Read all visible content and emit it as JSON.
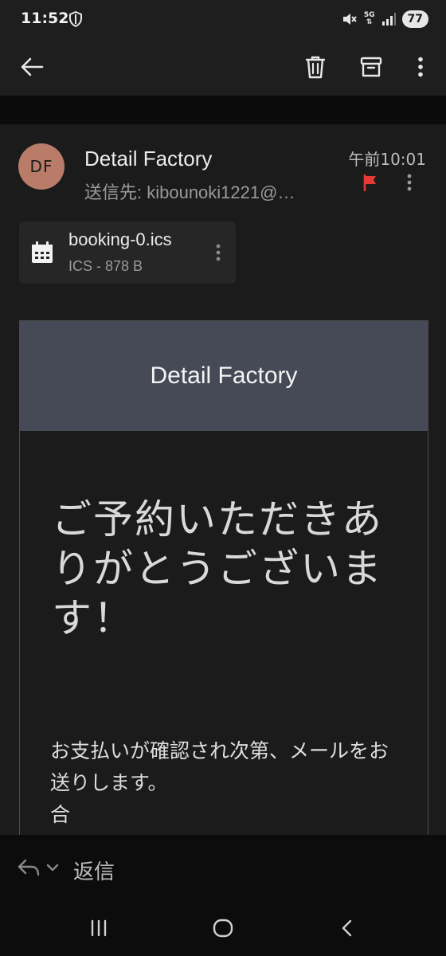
{
  "status_bar": {
    "time": "11:52",
    "network": "5G",
    "battery": "77"
  },
  "app_bar": {
    "icons": [
      "back-arrow-icon",
      "trash-icon",
      "archive-icon",
      "more-vert-icon"
    ]
  },
  "email": {
    "avatar_initials": "DF",
    "sender": "Detail Factory",
    "recipient": "送信先: kibounoki1221@…",
    "time": "午前10:01",
    "flag_color": "#e53935"
  },
  "attachment": {
    "name": "booking-0.ics",
    "meta": "ICS - 878 B",
    "icon": "calendar-icon"
  },
  "message": {
    "banner_title": "Detail Factory",
    "heading": "ご予約いただきありがとうございます！",
    "body": "お支払いが確認され次第、メールをお送りします。\n合"
  },
  "reply_bar": {
    "label": "返信"
  },
  "colors": {
    "background": "#1b1b1b",
    "banner": "#454a56",
    "avatar": "#b87c69",
    "flag": "#e53935"
  }
}
